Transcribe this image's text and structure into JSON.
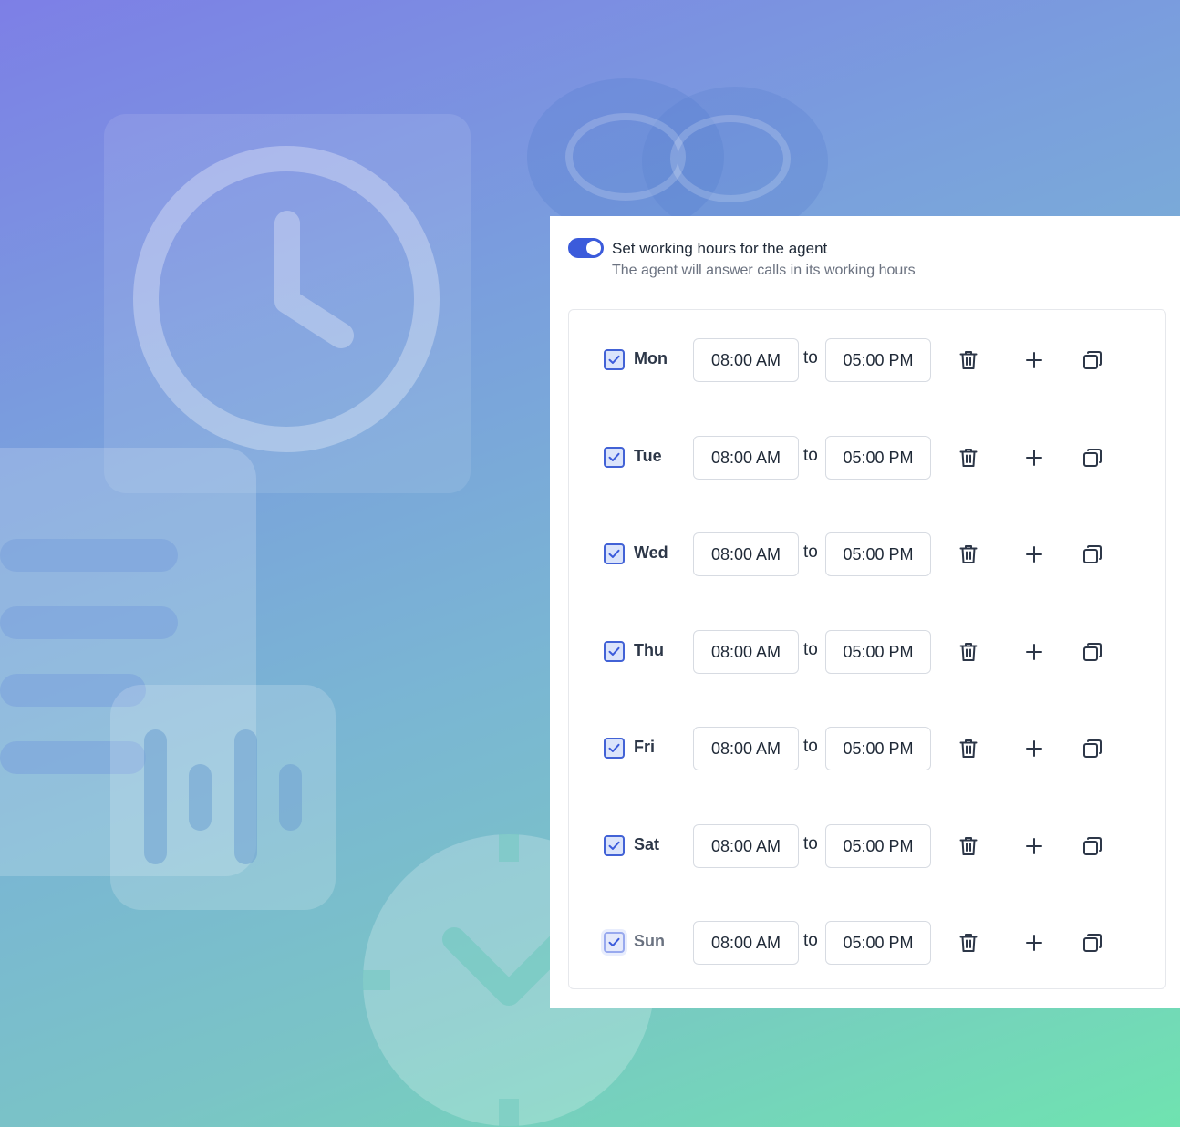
{
  "settings": {
    "toggle_title": "Set working hours for the agent",
    "toggle_subtitle": "The agent will answer calls in its working hours",
    "toggle_on": true
  },
  "schedule": {
    "separator": "to",
    "days": [
      {
        "label": "Mon",
        "checked": true,
        "from": "08:00 AM",
        "to": "05:00 PM"
      },
      {
        "label": "Tue",
        "checked": true,
        "from": "08:00 AM",
        "to": "05:00 PM"
      },
      {
        "label": "Wed",
        "checked": true,
        "from": "08:00 AM",
        "to": "05:00 PM"
      },
      {
        "label": "Thu",
        "checked": true,
        "from": "08:00 AM",
        "to": "05:00 PM"
      },
      {
        "label": "Fri",
        "checked": true,
        "from": "08:00 AM",
        "to": "05:00 PM"
      },
      {
        "label": "Sat",
        "checked": true,
        "from": "08:00 AM",
        "to": "05:00 PM"
      },
      {
        "label": "Sun",
        "checked": true,
        "from": "08:00 AM",
        "to": "05:00 PM"
      }
    ]
  },
  "colors": {
    "accent": "#3b5bdb",
    "text": "#1f2937",
    "muted": "#6b7280"
  },
  "icons": {
    "row_actions": [
      "trash-icon",
      "plus-icon",
      "copy-icon"
    ],
    "check": "checkmark-icon"
  }
}
